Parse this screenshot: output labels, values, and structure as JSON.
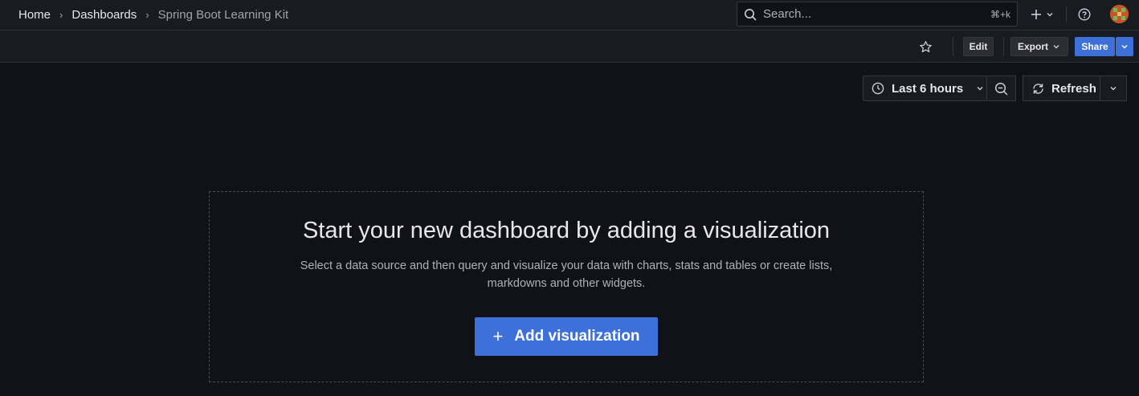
{
  "breadcrumbs": [
    {
      "label": "Home"
    },
    {
      "label": "Dashboards"
    },
    {
      "label": "Spring Boot Learning Kit"
    }
  ],
  "search": {
    "placeholder": "Search...",
    "shortcut": "⌘+k"
  },
  "topbar_icons": [
    "plus-icon",
    "chevron-down-icon",
    "help-icon",
    "avatar"
  ],
  "toolbar": {
    "star_icon": "star-icon",
    "edit_label": "Edit",
    "export_label": "Export",
    "share_label": "Share"
  },
  "time_controls": {
    "time_range": "Last 6 hours",
    "refresh_label": "Refresh"
  },
  "empty_state": {
    "title": "Start your new dashboard by adding a visualization",
    "description": "Select a data source and then query and visualize your data with charts, stats and tables or create lists, markdowns and other widgets.",
    "button_label": "Add visualization"
  },
  "colors": {
    "background": "#111217",
    "panel": "#181b1f",
    "primary": "#3d71d9",
    "text": "#e6e6ec"
  }
}
